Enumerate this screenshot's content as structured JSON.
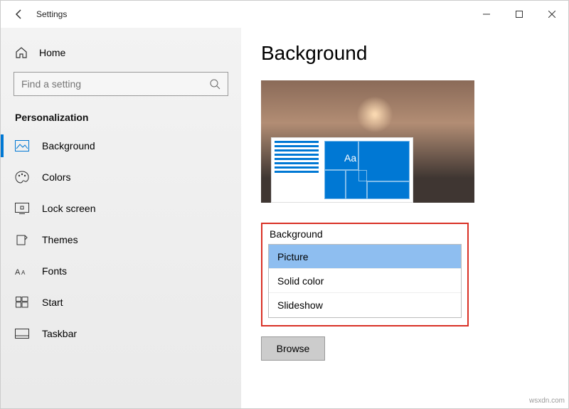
{
  "titlebar": {
    "title": "Settings"
  },
  "sidebar": {
    "home_label": "Home",
    "search_placeholder": "Find a setting",
    "section_title": "Personalization",
    "items": [
      {
        "label": "Background"
      },
      {
        "label": "Colors"
      },
      {
        "label": "Lock screen"
      },
      {
        "label": "Themes"
      },
      {
        "label": "Fonts"
      },
      {
        "label": "Start"
      },
      {
        "label": "Taskbar"
      }
    ]
  },
  "main": {
    "heading": "Background",
    "preview_sample_text": "Aa",
    "dropdown": {
      "label": "Background",
      "options": [
        {
          "label": "Picture",
          "selected": true
        },
        {
          "label": "Solid color",
          "selected": false
        },
        {
          "label": "Slideshow",
          "selected": false
        }
      ]
    },
    "browse_label": "Browse"
  },
  "watermark": "wsxdn.com"
}
